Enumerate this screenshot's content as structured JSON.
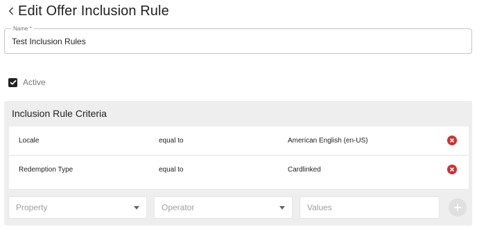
{
  "header": {
    "back_icon": "chevron-left-icon",
    "title": "Edit Offer Inclusion Rule"
  },
  "name_field": {
    "label": "Name *",
    "value": "Test Inclusion Rules"
  },
  "active": {
    "label": "Active",
    "checked": true
  },
  "criteria": {
    "title": "Inclusion Rule Criteria",
    "rows": [
      {
        "property": "Locale",
        "operator": "equal to",
        "value": "American English (en-US)"
      },
      {
        "property": "Redemption Type",
        "operator": "equal to",
        "value": "Cardlinked"
      }
    ],
    "new_rule": {
      "property_placeholder": "Property",
      "operator_placeholder": "Operator",
      "values_placeholder": "Values"
    }
  },
  "colors": {
    "remove": "#d32f2f",
    "card_bg": "#eeeeee",
    "checkbox": "#212121"
  }
}
